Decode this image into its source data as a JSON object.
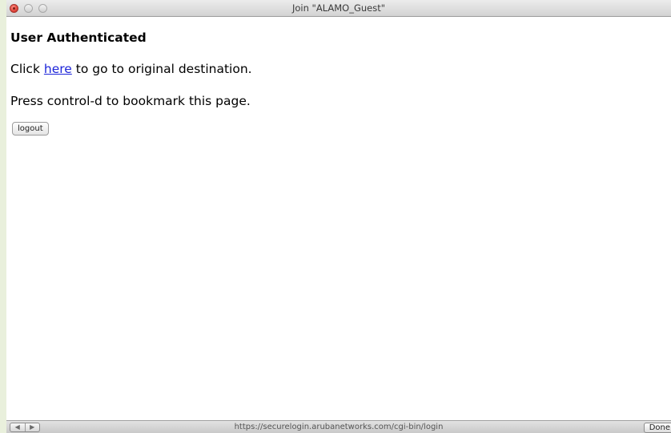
{
  "window": {
    "title": "Join \"ALAMO_Guest\""
  },
  "page": {
    "heading": "User Authenticated",
    "line1_prefix": "Click ",
    "line1_link": "here",
    "line1_suffix": " to go to original destination.",
    "line2": "Press control-d to bookmark this page.",
    "logout_label": "logout"
  },
  "statusbar": {
    "back_icon": "◀",
    "forward_icon": "▶",
    "url": "https://securelogin.arubanetworks.com/cgi-bin/login",
    "done_label": "Done"
  },
  "colors": {
    "link": "#1d25d9",
    "background": "#e9f0dc",
    "close_button": "#e0443a"
  },
  "icons": {
    "close": "close-circle-icon",
    "minimize": "minimize-circle-icon",
    "zoom": "zoom-circle-icon",
    "back": "back-arrow-icon",
    "forward": "forward-arrow-icon"
  }
}
